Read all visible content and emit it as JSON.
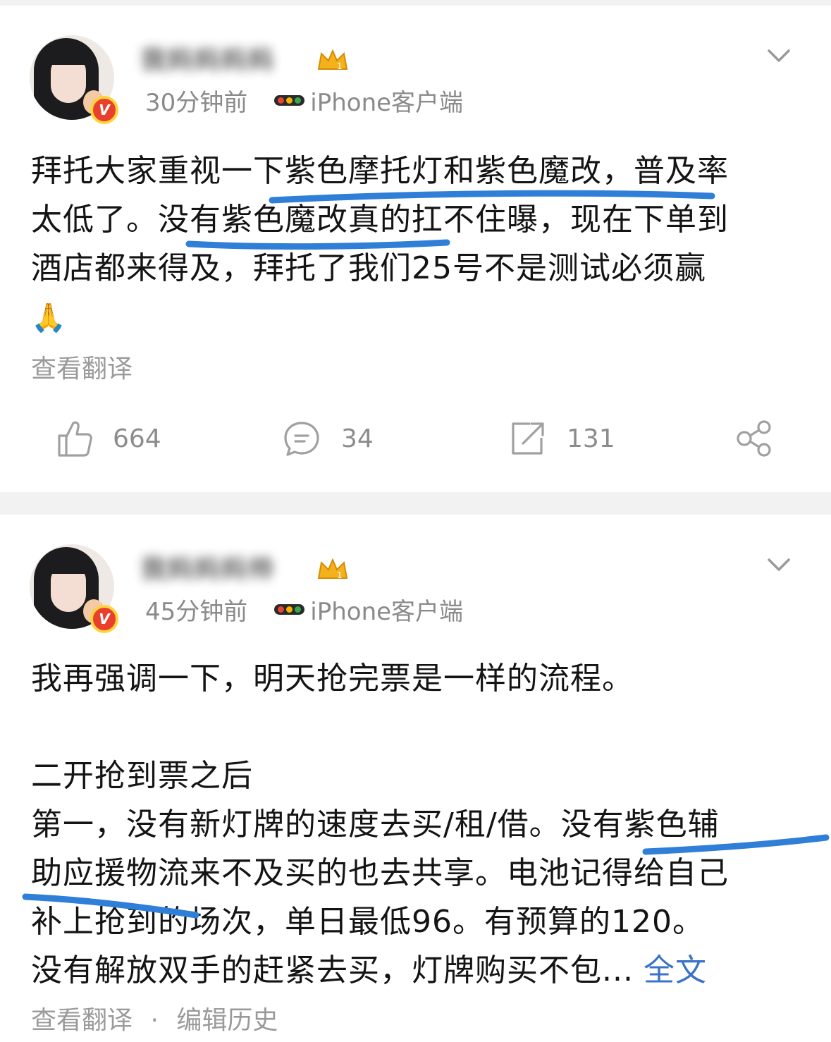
{
  "posts": [
    {
      "username": "我妈妈妈妈",
      "time": "30分钟前",
      "client": "iPhone客户端",
      "verified_badge": "V",
      "body_lines": [
        "拜托大家重视一下紫色摩托灯和紫色魔改，普及率",
        "太低了。没有紫色魔改真的扛不住曝，现在下单到",
        "酒店都来得及，拜托了我们25号不是测试必须赢"
      ],
      "emoji": "🙏",
      "translate_label": "查看翻译",
      "actions": {
        "likes": "664",
        "comments": "34",
        "reposts": "131"
      }
    },
    {
      "username": "我妈妈妈帅",
      "time": "45分钟前",
      "client": "iPhone客户端",
      "verified_badge": "V",
      "body_lines": [
        "我再强调一下，明天抢完票是一样的流程。",
        "二开抢到票之后",
        "第一，没有新灯牌的速度去买/租/借。没有紫色辅",
        "助应援物流来不及买的也去共享。电池记得给自己",
        "补上抢到的场次，单日最低96。有预算的120。",
        "没有解放双手的赶紧去买，灯牌购买不包..."
      ],
      "full_text_link": "全文",
      "translate_label": "查看翻译",
      "edit_history_label": "编辑历史",
      "separator": "·"
    }
  ],
  "colors": {
    "underline": "#2f7fd8",
    "link": "#3a73c7",
    "meta_gray": "#8a8a8a",
    "divider": "#f2f2f2"
  },
  "icons": [
    "chevron-down-icon",
    "like-icon",
    "comment-icon",
    "repost-icon",
    "share-icon",
    "crown-icon",
    "traffic-light-icon",
    "verified-icon"
  ]
}
